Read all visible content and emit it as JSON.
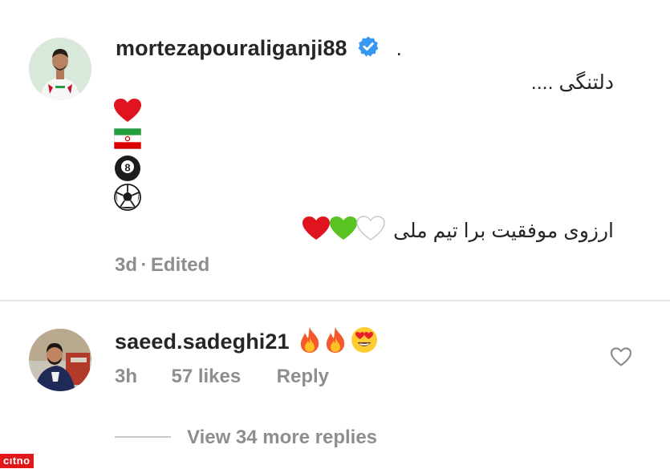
{
  "comment": {
    "username": "mortezapouraliganji88",
    "trailing": ".",
    "lines": {
      "line1": "دلتنگی ....",
      "wish": "ارزوی موفقیت برا تیم ملی"
    },
    "emojis": [
      "red-heart",
      "iran-flag",
      "8-ball",
      "soccer-ball"
    ],
    "heart_row": [
      "white-heart",
      "green-heart",
      "red-heart"
    ],
    "time": "3d",
    "separator": "·",
    "edited": "Edited"
  },
  "reply": {
    "username": "saeed.sadeghi21",
    "emojis": [
      "fire",
      "fire",
      "heart-eyes"
    ],
    "time": "3h",
    "likes": "57 likes",
    "reply_label": "Reply"
  },
  "view_replies": "View 34 more replies",
  "watermark": "cıtno",
  "colors": {
    "verified": "#3897f0",
    "meta": "#8e8e8e",
    "text": "#262626"
  }
}
